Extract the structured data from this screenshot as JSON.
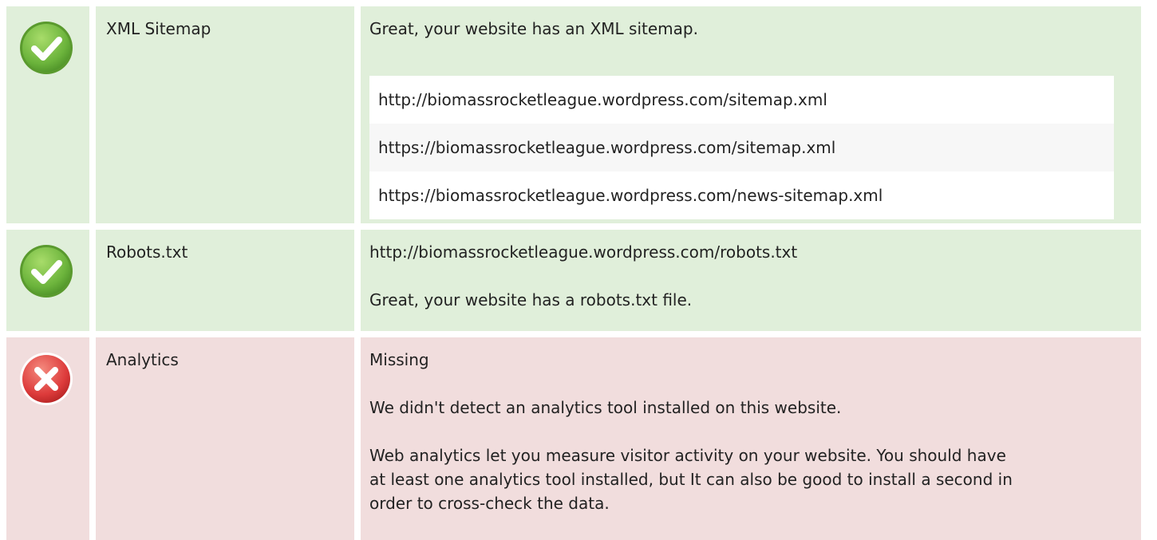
{
  "checks": [
    {
      "status": "pass",
      "status_icon": "check-circle-icon",
      "label": "XML Sitemap",
      "summary": "Great, your website has an XML sitemap.",
      "sitemaps": [
        "http://biomassrocketleague.wordpress.com/sitemap.xml",
        "https://biomassrocketleague.wordpress.com/sitemap.xml",
        "https://biomassrocketleague.wordpress.com/news-sitemap.xml"
      ]
    },
    {
      "status": "pass",
      "status_icon": "check-circle-icon",
      "label": "Robots.txt",
      "url": "http://biomassrocketleague.wordpress.com/robots.txt",
      "summary": "Great, your website has a robots.txt file."
    },
    {
      "status": "fail",
      "status_icon": "error-circle-icon",
      "label": "Analytics",
      "headline": "Missing",
      "summary": "We didn't detect an analytics tool installed on this website.",
      "advice": "Web analytics let you measure visitor activity on your website. You should have at least one analytics tool installed, but It can also be good to install a second in order to cross-check the data."
    }
  ],
  "colors": {
    "pass_background": "#e0efda",
    "fail_background": "#f1dddd",
    "pass_icon": "#6cb43c",
    "fail_icon": "#dd3b3b"
  }
}
